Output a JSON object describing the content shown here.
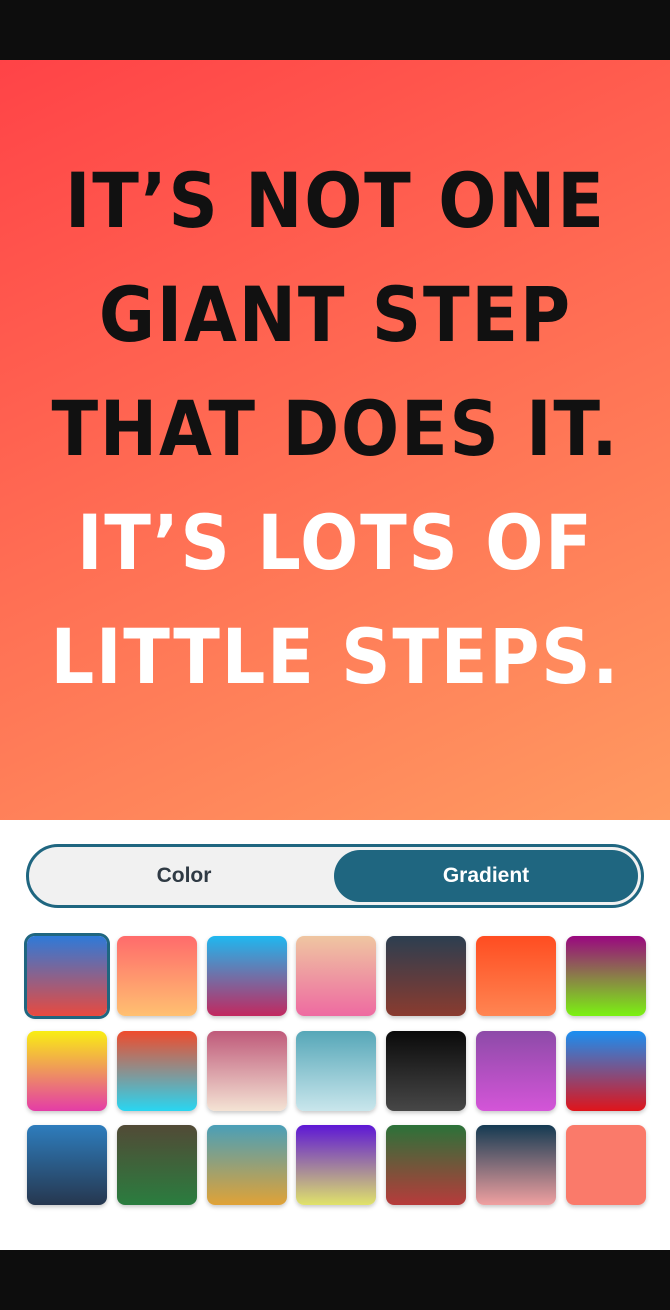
{
  "quote": {
    "lines": [
      {
        "text": "IT’S NOT ONE",
        "color": "#111111"
      },
      {
        "text": "GIANT STEP",
        "color": "#111111"
      },
      {
        "text": "THAT DOES IT.",
        "color": "#111111"
      },
      {
        "text": "IT’S LOTS OF",
        "color": "#ffffff"
      },
      {
        "text": "LITTLE STEPS.",
        "color": "#ffffff"
      }
    ]
  },
  "canvas": {
    "background": [
      "#ff4347",
      "#ff9a61"
    ]
  },
  "mode_toggle": {
    "color_label": "Color",
    "gradient_label": "Gradient",
    "selected": "Gradient",
    "accent": "#1f6680"
  },
  "gradients": [
    {
      "from": "#2e7ad9",
      "to": "#e84a3f",
      "selected": true
    },
    {
      "from": "#ff6b6b",
      "to": "#ffc071"
    },
    {
      "from": "#1fb8f0",
      "to": "#c2285f"
    },
    {
      "from": "#efc6a1",
      "to": "#ee6aa1"
    },
    {
      "from": "#2c3e50",
      "to": "#8a3b2f"
    },
    {
      "from": "#ff4d21",
      "to": "#ff8552"
    },
    {
      "from": "#9a0780",
      "to": "#7bf212"
    },
    {
      "from": "#f9ee13",
      "to": "#e43ca7"
    },
    {
      "from": "#ef4b2c",
      "to": "#28d6f2"
    },
    {
      "from": "#bf5a7a",
      "to": "#f4e3d4"
    },
    {
      "from": "#56a7b8",
      "to": "#c9e6ec"
    },
    {
      "from": "#0a0a0a",
      "to": "#474747"
    },
    {
      "from": "#8d4ba8",
      "to": "#d455d8"
    },
    {
      "from": "#1a8ff2",
      "to": "#e0141a"
    },
    {
      "from": "#2e7dbd",
      "to": "#26374f"
    },
    {
      "from": "#524a36",
      "to": "#2a7d3f"
    },
    {
      "from": "#4a9fb8",
      "to": "#e0a237"
    },
    {
      "from": "#5d17d6",
      "to": "#e0e36a"
    },
    {
      "from": "#2b7239",
      "to": "#b73b3b"
    },
    {
      "from": "#143a52",
      "to": "#f0a0a0"
    },
    {
      "from": "#fa7a6a",
      "to": "#fa7a6a"
    }
  ]
}
